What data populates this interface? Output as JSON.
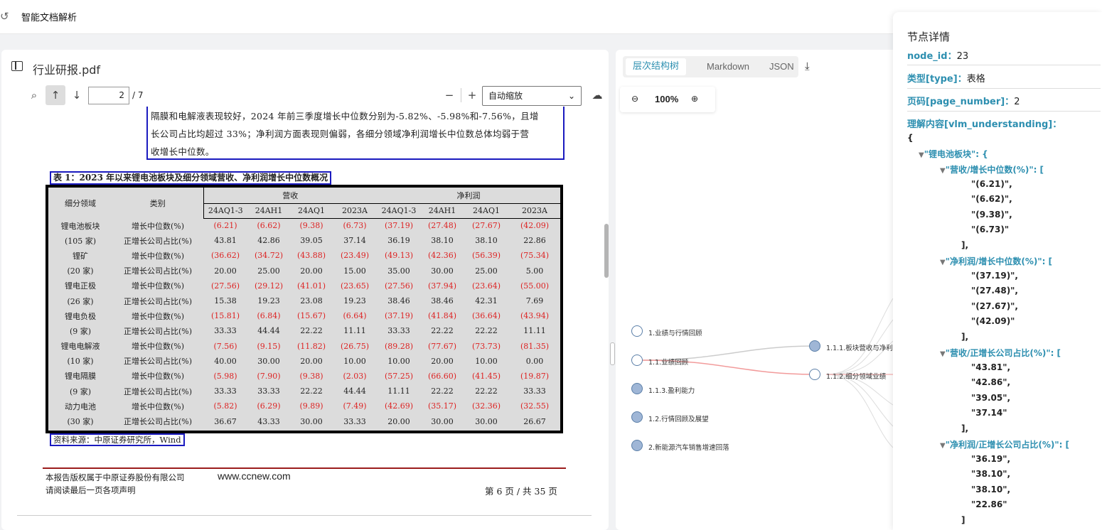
{
  "app": {
    "title": "智能文档解析"
  },
  "pdf": {
    "file_name": "行业研报.pdf",
    "page_current": "2",
    "page_total": "/ 7",
    "zoom_mode": "自动缩放",
    "paragraph": [
      "隔膜和电解液表现较好，2024 年前三季度增长中位数分别为-5.82%、-5.98%和-7.56%，且增",
      "长公司占比均超过 33%；净利润方面表现则偏弱，各细分领域净利润增长中位数总体均弱于营",
      "收增长中位数。"
    ],
    "table_caption": "表 1：2023 年以来锂电池板块及细分领域营收、净利润增长中位数概况",
    "table": {
      "col_segment": "细分领域",
      "col_category": "类别",
      "group_revenue": "营收",
      "group_profit": "净利润",
      "periods": [
        "24AQ1-3",
        "24AH1",
        "24AQ1",
        "2023A",
        "24AQ1-3",
        "24AH1",
        "24AQ1",
        "2023A"
      ],
      "rows": [
        {
          "seg": "锂电池板块",
          "cat": "增长中位数(%)",
          "vals": [
            "(6.21)",
            "(6.62)",
            "(9.38)",
            "(6.73)",
            "(37.19)",
            "(27.48)",
            "(27.67)",
            "(42.09)"
          ]
        },
        {
          "seg": "(105 家)",
          "cat": "正增长公司占比(%)",
          "vals": [
            "43.81",
            "42.86",
            "39.05",
            "37.14",
            "36.19",
            "38.10",
            "38.10",
            "22.86"
          ]
        },
        {
          "seg": "锂矿",
          "cat": "增长中位数(%)",
          "vals": [
            "(36.62)",
            "(34.72)",
            "(43.88)",
            "(23.49)",
            "(49.13)",
            "(42.36)",
            "(56.39)",
            "(75.34)"
          ]
        },
        {
          "seg": "(20 家)",
          "cat": "正增长公司占比(%)",
          "vals": [
            "20.00",
            "25.00",
            "20.00",
            "15.00",
            "35.00",
            "30.00",
            "25.00",
            "5.00"
          ]
        },
        {
          "seg": "锂电正极",
          "cat": "增长中位数(%)",
          "vals": [
            "(27.56)",
            "(29.12)",
            "(41.01)",
            "(23.65)",
            "(27.56)",
            "(37.94)",
            "(23.64)",
            "(55.00)"
          ]
        },
        {
          "seg": "(26 家)",
          "cat": "正增长公司占比(%)",
          "vals": [
            "15.38",
            "19.23",
            "23.08",
            "19.23",
            "38.46",
            "38.46",
            "42.31",
            "7.69"
          ]
        },
        {
          "seg": "锂电负极",
          "cat": "增长中位数(%)",
          "vals": [
            "(15.81)",
            "(6.84)",
            "(15.67)",
            "(6.64)",
            "(37.19)",
            "(41.84)",
            "(36.64)",
            "(43.94)"
          ]
        },
        {
          "seg": "(9 家)",
          "cat": "正增长公司占比(%)",
          "vals": [
            "33.33",
            "44.44",
            "22.22",
            "11.11",
            "33.33",
            "22.22",
            "22.22",
            "11.11"
          ]
        },
        {
          "seg": "锂电电解液",
          "cat": "增长中位数(%)",
          "vals": [
            "(7.56)",
            "(9.15)",
            "(11.82)",
            "(26.75)",
            "(89.28)",
            "(77.67)",
            "(73.73)",
            "(81.35)"
          ]
        },
        {
          "seg": "(10 家)",
          "cat": "正增长公司占比(%)",
          "vals": [
            "40.00",
            "30.00",
            "20.00",
            "10.00",
            "10.00",
            "20.00",
            "10.00",
            "0.00"
          ]
        },
        {
          "seg": "锂电隔膜",
          "cat": "增长中位数(%)",
          "vals": [
            "(5.98)",
            "(7.90)",
            "(9.38)",
            "(2.03)",
            "(57.25)",
            "(66.60)",
            "(41.45)",
            "(19.87)"
          ]
        },
        {
          "seg": "(9 家)",
          "cat": "正增长公司占比(%)",
          "vals": [
            "33.33",
            "33.33",
            "22.22",
            "44.44",
            "11.11",
            "22.22",
            "22.22",
            "33.33"
          ]
        },
        {
          "seg": "动力电池",
          "cat": "增长中位数(%)",
          "vals": [
            "(5.82)",
            "(6.29)",
            "(9.89)",
            "(7.49)",
            "(42.69)",
            "(35.17)",
            "(32.36)",
            "(32.55)"
          ]
        },
        {
          "seg": "(30 家)",
          "cat": "正增长公司占比(%)",
          "vals": [
            "36.67",
            "43.33",
            "30.00",
            "33.33",
            "20.00",
            "30.00",
            "30.00",
            "26.67"
          ]
        }
      ]
    },
    "source": "资料来源：中原证券研究所，Wind",
    "footer_copyright": "本报告版权属于中原证券股份有限公司",
    "footer_url": "www.ccnew.com",
    "footer_notice": "请阅读最后一页各项声明",
    "footer_page": "第 6 页 / 共 35 页"
  },
  "tree": {
    "tabs": [
      "层次结构树",
      "Markdown",
      "JSON"
    ],
    "zoom": "100%",
    "nodes": [
      {
        "label": "1.业绩与行情回顾"
      },
      {
        "label": "1.1.业绩回顾"
      },
      {
        "label": "1.1.3.盈利能力"
      },
      {
        "label": "1.2.行情回顾及展望"
      },
      {
        "label": "2.新能源汽车销售增速回落"
      },
      {
        "label": "1.1.1.板块营收与净利"
      },
      {
        "label": "1.1.2.细分领域业绩"
      }
    ]
  },
  "detail": {
    "title": "节点详情",
    "node_id_label": "node_id：",
    "node_id": "23",
    "type_label": "类型[type]：",
    "type": "表格",
    "page_label": "页码[page_number]：",
    "page": "2",
    "understanding_label": "理解内容[vlm_understanding]：",
    "json_open": "{",
    "root_key": "\"锂电池板块\": {",
    "groups": [
      {
        "key": "\"营收/增长中位数(%)\": [",
        "vals": [
          "\"(6.21)\",",
          "\"(6.62)\",",
          "\"(9.38)\",",
          "\"(6.73)\""
        ]
      },
      {
        "key": "\"净利润/增长中位数(%)\": [",
        "vals": [
          "\"(37.19)\",",
          "\"(27.48)\",",
          "\"(27.67)\",",
          "\"(42.09)\""
        ]
      },
      {
        "key": "\"营收/正增长公司占比(%)\": [",
        "vals": [
          "\"43.81\",",
          "\"42.86\",",
          "\"39.05\",",
          "\"37.14\""
        ]
      },
      {
        "key": "\"净利润/正增长公司占比(%)\": [",
        "vals": [
          "\"36.19\",",
          "\"38.10\",",
          "\"38.10\",",
          "\"22.86\""
        ]
      }
    ],
    "close_comma": "],",
    "close_last": "]"
  },
  "colors": {
    "accent": "#2d8fb0",
    "negative": "#d22222",
    "highlight_box": "#1a1abf"
  }
}
